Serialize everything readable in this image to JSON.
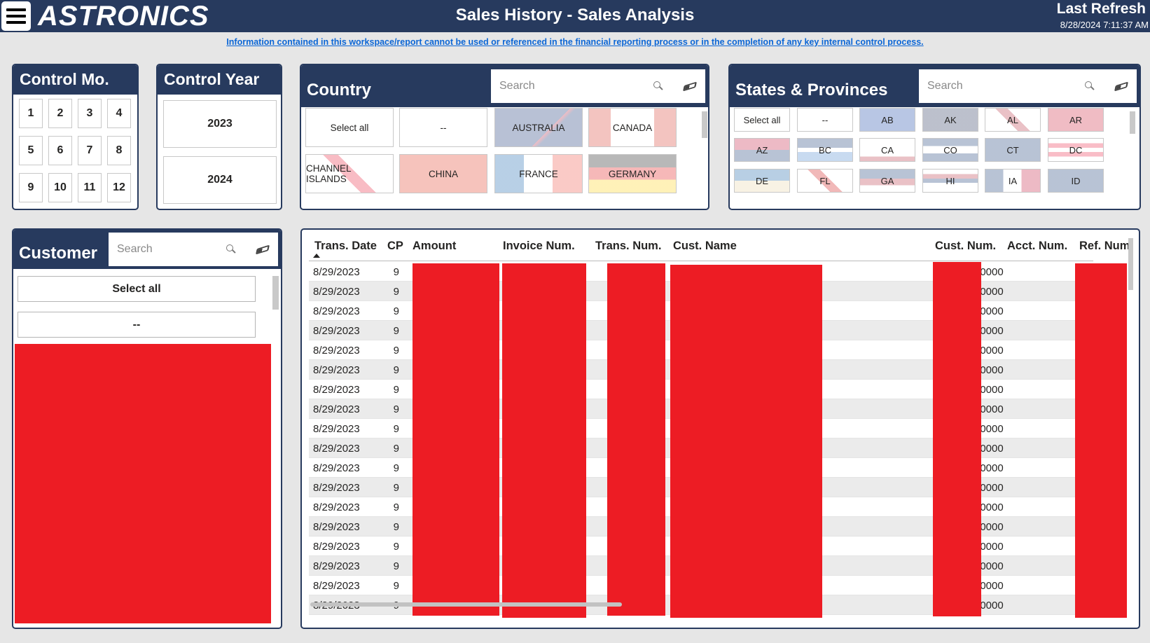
{
  "header": {
    "logo": "ASTRONICS",
    "title": "Sales History - Sales Analysis",
    "refresh_label": "Last Refresh",
    "refresh_time": "8/28/2024 7:11:37 AM"
  },
  "disclaimer": "Information contained in this workspace/report cannot be used or referenced in the financial reporting process or in the completion of any key internal control process.",
  "control_mo": {
    "title": "Control Mo.",
    "items": [
      "1",
      "2",
      "3",
      "4",
      "5",
      "6",
      "7",
      "8",
      "9",
      "10",
      "11",
      "12"
    ]
  },
  "control_year": {
    "title": "Control Year",
    "items": [
      "2023",
      "2024"
    ]
  },
  "country": {
    "title": "Country",
    "search_placeholder": "Search",
    "items": [
      "Select all",
      "--",
      "AUSTRALIA",
      "CANADA",
      "CHANNEL ISLANDS",
      "CHINA",
      "FRANCE",
      "GERMANY"
    ]
  },
  "states": {
    "title": "States & Provinces",
    "search_placeholder": "Search",
    "items": [
      "Select all",
      "--",
      "AB",
      "AK",
      "AL",
      "AR",
      "AZ",
      "BC",
      "CA",
      "CO",
      "CT",
      "DC",
      "DE",
      "FL",
      "GA",
      "HI",
      "IA",
      "ID"
    ]
  },
  "customer": {
    "title": "Customer",
    "search_placeholder": "Search",
    "items": [
      "Select all",
      "--"
    ]
  },
  "table": {
    "columns": [
      "Trans. Date",
      "CP",
      "Amount",
      "Invoice Num.",
      "Trans. Num.",
      "Cust. Name",
      "Cust. Num.",
      "Acct. Num.",
      "Ref. Num"
    ],
    "sort_column": "Trans. Date",
    "rows": [
      {
        "date": "8/29/2023",
        "cp": "9",
        "acct": "40000"
      },
      {
        "date": "8/29/2023",
        "cp": "9",
        "acct": "40000"
      },
      {
        "date": "8/29/2023",
        "cp": "9",
        "acct": "40000"
      },
      {
        "date": "8/29/2023",
        "cp": "9",
        "acct": "40000"
      },
      {
        "date": "8/29/2023",
        "cp": "9",
        "acct": "40000"
      },
      {
        "date": "8/29/2023",
        "cp": "9",
        "acct": "40000"
      },
      {
        "date": "8/29/2023",
        "cp": "9",
        "acct": "40000"
      },
      {
        "date": "8/29/2023",
        "cp": "9",
        "acct": "40000"
      },
      {
        "date": "8/29/2023",
        "cp": "9",
        "acct": "40000"
      },
      {
        "date": "8/29/2023",
        "cp": "9",
        "acct": "40000"
      },
      {
        "date": "8/29/2023",
        "cp": "9",
        "acct": "40000"
      },
      {
        "date": "8/29/2023",
        "cp": "9",
        "acct": "40000"
      },
      {
        "date": "8/29/2023",
        "cp": "9",
        "acct": "40000"
      },
      {
        "date": "8/29/2023",
        "cp": "9",
        "acct": "40000"
      },
      {
        "date": "8/29/2023",
        "cp": "9",
        "acct": "40000"
      },
      {
        "date": "8/29/2023",
        "cp": "9",
        "acct": "40000"
      },
      {
        "date": "8/29/2023",
        "cp": "9",
        "acct": "40000"
      },
      {
        "date": "8/29/2023",
        "cp": "9",
        "acct": "40000"
      }
    ]
  },
  "colors": {
    "navy": "#273a5e",
    "redaction": "#ed1c24",
    "link": "#0b66d6"
  }
}
